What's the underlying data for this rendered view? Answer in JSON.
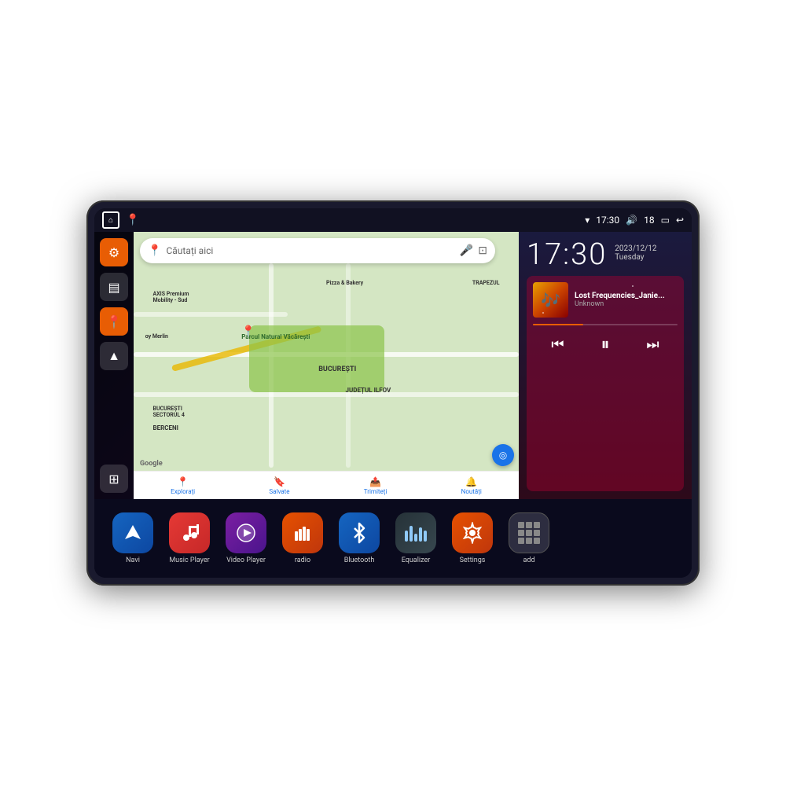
{
  "device": {
    "status_bar": {
      "home_icon": "⌂",
      "location_icon": "📍",
      "wifi_icon": "▾",
      "time": "17:30",
      "volume_icon": "🔊",
      "battery_level": "18",
      "battery_icon": "🔋",
      "back_icon": "↩"
    },
    "clock": {
      "time": "17:30",
      "date": "2023/12/12",
      "day": "Tuesday"
    },
    "music": {
      "title": "Lost Frequencies_Janie...",
      "artist": "Unknown",
      "prev_icon": "⏮",
      "pause_icon": "⏸",
      "next_icon": "⏭"
    },
    "map": {
      "search_placeholder": "Căutați aici",
      "labels": [
        "AXIS Premium Mobility - Sud",
        "Pizza & Bakery",
        "TRAPEZUL",
        "Parcul Natural Văcărești",
        "BUCUREȘTI",
        "JUDEȚUL ILFOV",
        "BUCUREȘTI SECTORUL 4",
        "BERCENI",
        "oy Merlin"
      ],
      "bottom_items": [
        {
          "icon": "📍",
          "label": "Explorați"
        },
        {
          "icon": "🔖",
          "label": "Salvate"
        },
        {
          "icon": "📤",
          "label": "Trimiteți"
        },
        {
          "icon": "🔔",
          "label": "Noutăți"
        }
      ]
    },
    "sidebar": {
      "items": [
        {
          "icon": "⚙",
          "color": "orange",
          "label": "settings"
        },
        {
          "icon": "▤",
          "color": "dark",
          "label": "menu"
        },
        {
          "icon": "📍",
          "color": "orange",
          "label": "location"
        },
        {
          "icon": "▲",
          "color": "dark",
          "label": "navigation"
        }
      ],
      "bottom_icon": "⊞"
    },
    "apps": [
      {
        "icon": "▲",
        "label": "Navi",
        "bg": "bg-blue-nav",
        "type": "arrow"
      },
      {
        "icon": "🎵",
        "label": "Music Player",
        "bg": "bg-red-music",
        "type": "note"
      },
      {
        "icon": "▶",
        "label": "Video Player",
        "bg": "bg-purple-video",
        "type": "play"
      },
      {
        "icon": "📻",
        "label": "radio",
        "bg": "bg-orange-radio",
        "type": "wave"
      },
      {
        "icon": "⚡",
        "label": "Bluetooth",
        "bg": "bg-blue-bt",
        "type": "bluetooth"
      },
      {
        "icon": "📊",
        "label": "Equalizer",
        "bg": "bg-dark-eq",
        "type": "eq"
      },
      {
        "icon": "⚙",
        "label": "Settings",
        "bg": "bg-orange-settings",
        "type": "gear"
      },
      {
        "icon": "+",
        "label": "add",
        "bg": "bg-dark-add",
        "type": "add"
      }
    ]
  }
}
